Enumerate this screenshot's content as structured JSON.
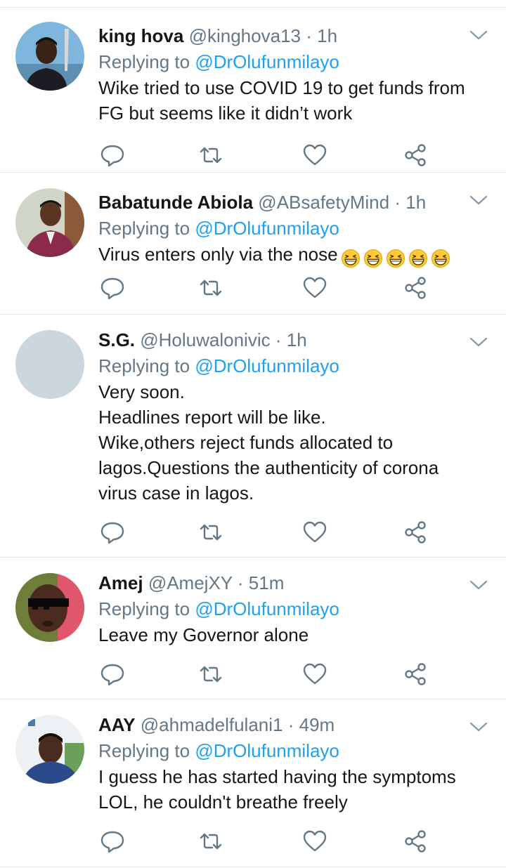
{
  "separator": "·",
  "reply_prefix": "Replying to",
  "tweets": [
    {
      "name": "king hova",
      "handle": "@kinghova13",
      "time": "1h",
      "replying_to": "@DrOlufunmilayo",
      "text": "Wike tried to use COVID 19 to get funds from\nFG but seems like it didn’t work"
    },
    {
      "name": "Babatunde Abiola",
      "handle": "@ABsafetyMind",
      "time": "1h",
      "replying_to": "@DrOlufunmilayo",
      "text": "Virus enters only via the nose",
      "emoji": [
        "grinning-squinting-face",
        "grinning-squinting-face",
        "grinning-squinting-face",
        "grinning-squinting-face",
        "grinning-squinting-face"
      ]
    },
    {
      "name": "S.G.",
      "handle": "@Holuwalonivic",
      "time": "1h",
      "replying_to": "@DrOlufunmilayo",
      "text": "Very soon.\nHeadlines report will be like.\nWike,others reject funds allocated to\nlagos.Questions the authenticity of corona\nvirus case in lagos."
    },
    {
      "name": "Amej",
      "handle": "@AmejXY",
      "time": "51m",
      "replying_to": "@DrOlufunmilayo",
      "text": "Leave my Governor alone"
    },
    {
      "name": "AAY",
      "handle": "@ahmadelfulani1",
      "time": "49m",
      "replying_to": "@DrOlufunmilayo",
      "text": "I guess he has started having the symptoms\nLOL, he couldn't breathe freely"
    }
  ],
  "icons": {
    "reply": "reply-icon",
    "retweet": "retweet-icon",
    "like": "heart-icon",
    "share": "share-icon",
    "menu": "chevron-down-icon"
  },
  "colors": {
    "link": "#1da1f2",
    "secondary_text": "#657786",
    "divider": "#e1e8ed",
    "icon": "#657786"
  }
}
